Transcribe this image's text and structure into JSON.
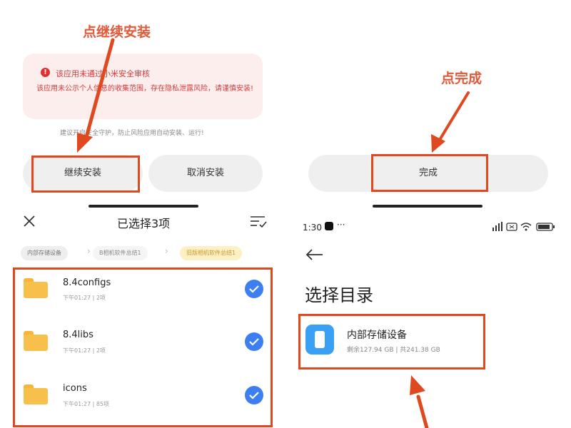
{
  "annotations": {
    "tap_continue": "点继续安装",
    "tap_done": "点完成"
  },
  "install_dialog": {
    "warning_title": "该应用未通过小米安全审核",
    "warning_body": "该应用未公示个人信息的收集范围，存在隐私泄露风险，请谨慎安装!",
    "hint": "建议开启安全守护，防止风险应用自动安装、运行!",
    "continue_button": "继续安装",
    "cancel_button": "取消安装"
  },
  "done_screen": {
    "done_button": "完成"
  },
  "file_picker": {
    "title": "已选择3项",
    "breadcrumbs": [
      "内部存储设备",
      "B相机软件总结1",
      "旧版相机软件总结1"
    ],
    "items": [
      {
        "name": "8.4configs",
        "meta": "下午01:27 | 2项"
      },
      {
        "name": "8.4libs",
        "meta": "下午01:27 | 2项"
      },
      {
        "name": "icons",
        "meta": "下午01:27 | 85项"
      }
    ]
  },
  "directory_picker": {
    "status_time": "1:30",
    "status_dots": "···",
    "title": "选择目录",
    "storage_name": "内部存储设备",
    "storage_detail": "剩余127.94 GB | 共241.38 GB"
  },
  "colors": {
    "annotation_red": "#e0481f",
    "warning_red": "#d23c3c",
    "check_blue": "#3d7ff0",
    "folder_yellow": "#f7c04a",
    "storage_blue": "#3aa0f4"
  }
}
